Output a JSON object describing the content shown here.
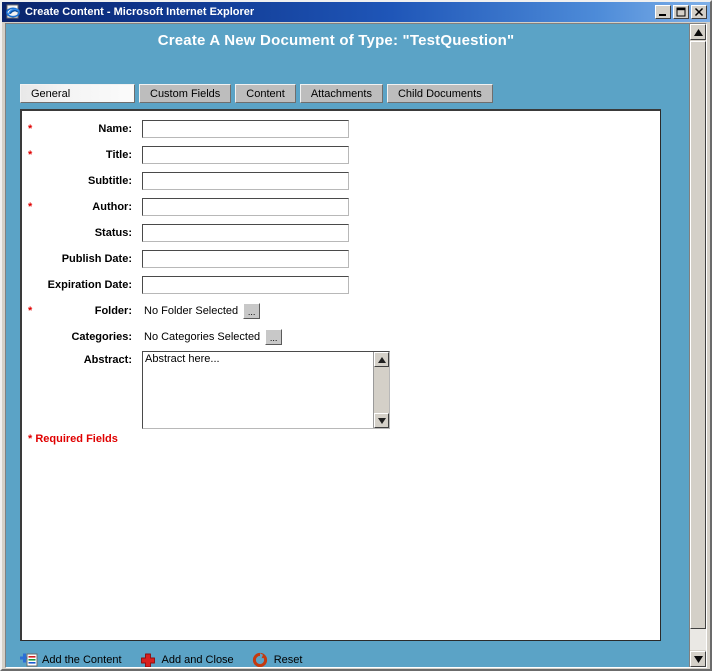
{
  "window": {
    "title": "Create Content - Microsoft Internet Explorer",
    "icon": "internet-explorer-icon",
    "minimize_label": "Minimize",
    "maximize_label": "Maximize",
    "close_label": "Close"
  },
  "page": {
    "heading": "Create A New Document of Type: \"TestQuestion\"",
    "background_color": "#5ba3c6"
  },
  "tabs": [
    {
      "label": "General",
      "active": true
    },
    {
      "label": "Custom Fields",
      "active": false
    },
    {
      "label": "Content",
      "active": false
    },
    {
      "label": "Attachments",
      "active": false
    },
    {
      "label": "Child Documents",
      "active": false
    }
  ],
  "form": {
    "fields": [
      {
        "label": "Name:",
        "required": true,
        "value": "",
        "type": "text"
      },
      {
        "label": "Title:",
        "required": true,
        "value": "",
        "type": "text"
      },
      {
        "label": "Subtitle:",
        "required": false,
        "value": "",
        "type": "text"
      },
      {
        "label": "Author:",
        "required": true,
        "value": "",
        "type": "text"
      },
      {
        "label": "Status:",
        "required": false,
        "value": "",
        "type": "text"
      },
      {
        "label": "Publish Date:",
        "required": false,
        "value": "",
        "type": "text"
      },
      {
        "label": "Expiration Date:",
        "required": false,
        "value": "",
        "type": "text"
      }
    ],
    "folder": {
      "label": "Folder:",
      "required": true,
      "value": "No Folder Selected",
      "browse_label": "..."
    },
    "categories": {
      "label": "Categories:",
      "required": false,
      "value": "No Categories Selected",
      "browse_label": "..."
    },
    "abstract": {
      "label": "Abstract:",
      "required": false,
      "value": "Abstract here..."
    },
    "required_note": "* Required Fields",
    "required_color": "#e00000"
  },
  "toolbar": [
    {
      "label": "Add the Content",
      "icon": "add-document-icon"
    },
    {
      "label": "Add and Close",
      "icon": "red-plus-icon"
    },
    {
      "label": "Reset",
      "icon": "reset-circular-arrow-icon"
    }
  ],
  "scrollbar": {
    "up_label": "Scroll up",
    "down_label": "Scroll down"
  }
}
